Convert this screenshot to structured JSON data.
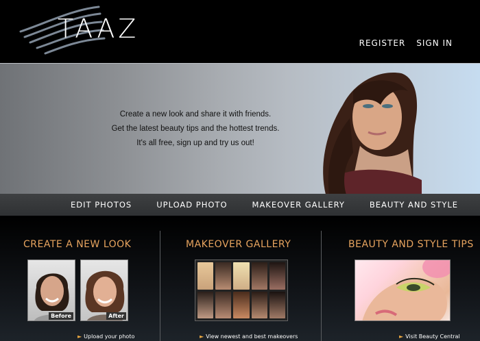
{
  "brand": {
    "logo_text": "TAAZ"
  },
  "header_links": {
    "register": "REGISTER",
    "sign_in": "SIGN IN"
  },
  "banner": {
    "tagline_1": "Create a new look and share it with friends.",
    "tagline_2": "Get the latest beauty tips and the hottest trends.",
    "tagline_3": "It's all free, sign up and try us out!"
  },
  "nav": {
    "edit_photos": "EDIT PHOTOS",
    "upload_photo": "UPLOAD PHOTO",
    "makeover_gallery": "MAKEOVER GALLERY",
    "beauty_and_style": "BEAUTY AND STYLE"
  },
  "sections": {
    "create": {
      "title": "CREATE A NEW LOOK",
      "before_label": "Before",
      "after_label": "After",
      "link": "Upload your photo"
    },
    "gallery": {
      "title": "MAKEOVER GALLERY",
      "link": "View newest and best makeovers"
    },
    "beauty": {
      "title": "BEAUTY AND STYLE TIPS",
      "link": "Visit Beauty Central"
    }
  },
  "colors": {
    "accent_orange": "#e7a45f",
    "arrow_gold": "#e8a640",
    "nav_bg": "#3a3c3e"
  }
}
